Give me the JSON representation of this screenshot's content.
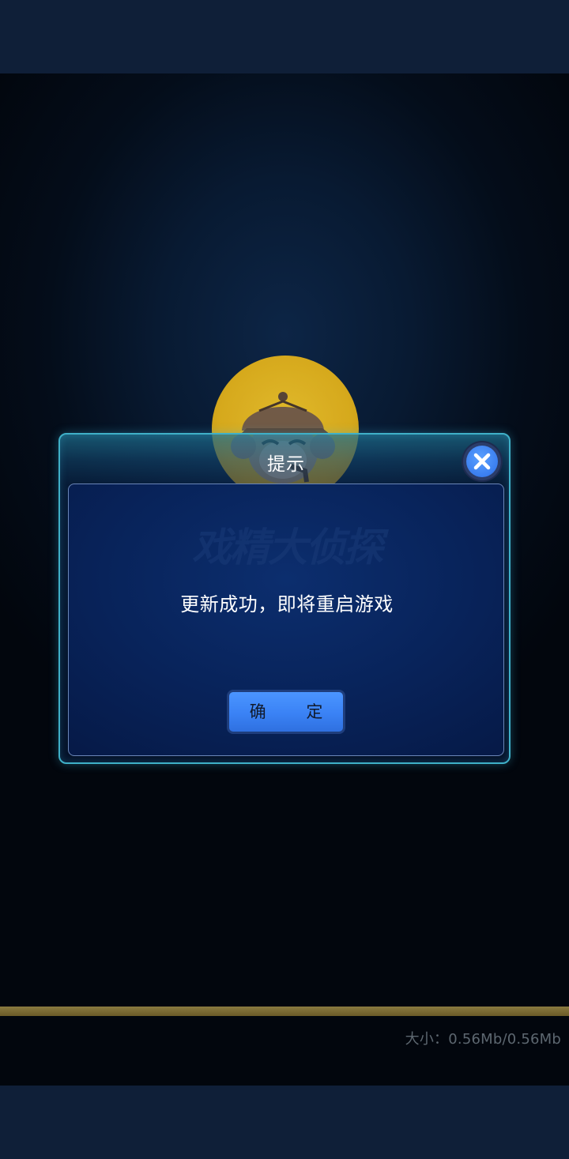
{
  "dialog": {
    "title": "提示",
    "message": "更新成功，即将重启游戏",
    "confirm_label": "确 定",
    "close_icon": "close-icon",
    "watermark": "戏精大侦探"
  },
  "download": {
    "size_text": "大小：0.56Mb/0.56Mb",
    "progress": 1.0
  },
  "logo": {
    "icon": "detective-monkey-logo-icon"
  },
  "colors": {
    "accent": "#3a82f5",
    "dialog_border": "#3fb0c8",
    "logo_yellow": "#e8b51a"
  }
}
